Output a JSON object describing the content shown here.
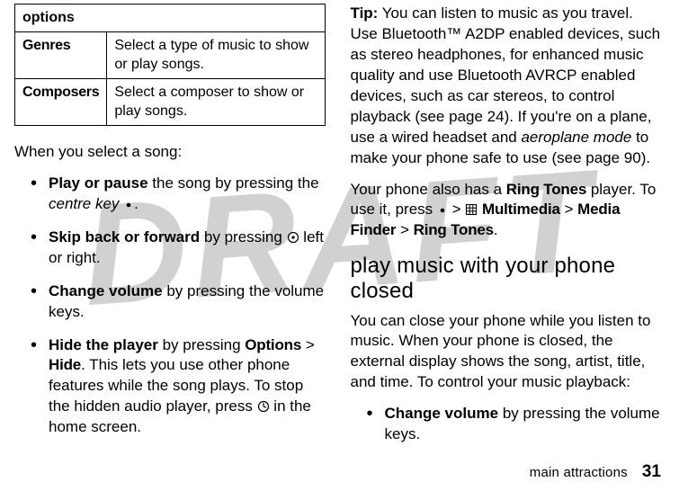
{
  "watermark": "DRAFT",
  "table": {
    "header": "options",
    "rows": [
      {
        "label": "Genres",
        "desc": "Select a type of music to show or play songs."
      },
      {
        "label": "Composers",
        "desc": "Select a composer to show or play songs."
      }
    ]
  },
  "left": {
    "lead": "When you select a song:",
    "bullets": {
      "b0": {
        "strong": "Play or pause",
        "rest1": " the song by pressing the ",
        "italic": "centre key",
        "rest2": "."
      },
      "b1": {
        "strong": "Skip back or forward",
        "rest1": " by pressing ",
        "rest2": " left or right."
      },
      "b2": {
        "strong": "Change volume",
        "rest": " by pressing the volume keys."
      },
      "b3": {
        "strong": "Hide the player",
        "rest1": " by pressing ",
        "opt": "Options",
        "gt": " > ",
        "hide": "Hide",
        "rest2": ". This lets you use other phone features while the song plays. To stop the hidden audio player, press ",
        "rest3": " in the home screen."
      }
    }
  },
  "right": {
    "tipLabel": "Tip:",
    "tipBody1": " You can listen to music as you travel. Use Bluetooth™ A2DP enabled devices, such as stereo headphones, for enhanced music quality and use Bluetooth AVRCP enabled devices, such as car stereos, to control playback (see page 24). If you're on a plane, use a wired headset and ",
    "tipItalic": "aeroplane mode",
    "tipBody2": " to make your phone safe to use (see page 90).",
    "para2a": "Your phone also has a ",
    "ringTones1": "Ring Tones",
    "para2b": " player. To use it, press ",
    "gt1": " > ",
    "multimedia": "Multimedia",
    "gt2": " > ",
    "mediaFinder": "Media Finder",
    "gt3": " > ",
    "ringTones2": "Ring Tones",
    "para2c": ".",
    "sectionHeading": "play music with your phone closed",
    "para3": "You can close your phone while you listen to music. When your phone is closed, the external display shows the song, artist, title, and time. To control your music playback:",
    "bullet": {
      "strong": "Change volume",
      "rest": " by pressing the volume keys."
    }
  },
  "footer": {
    "section": "main attractions",
    "page": "31"
  }
}
